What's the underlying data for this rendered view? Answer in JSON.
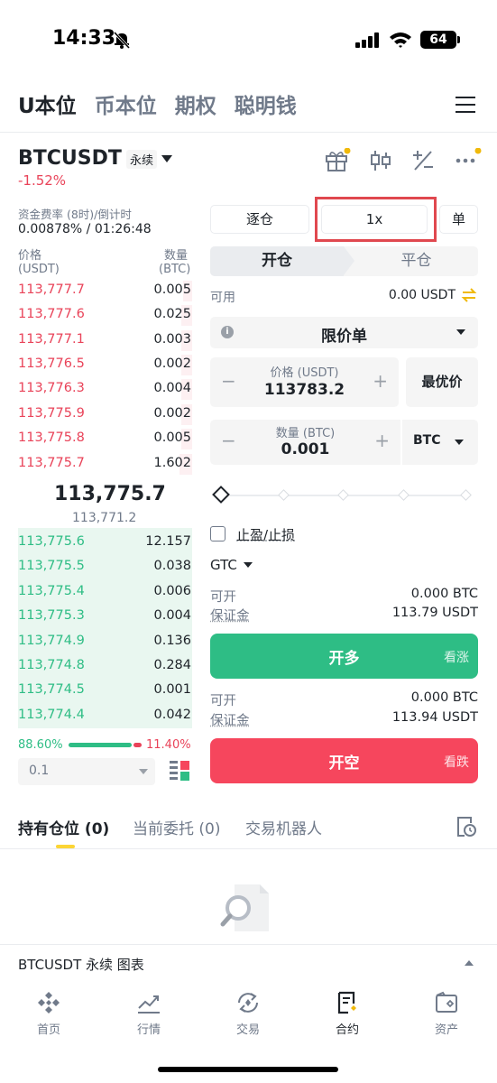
{
  "status_bar": {
    "time": "14:33",
    "battery": "64"
  },
  "top_tabs": [
    "U本位",
    "币本位",
    "期权",
    "聪明钱"
  ],
  "pair": {
    "name": "BTCUSDT",
    "type": "永续",
    "change": "-1.52%"
  },
  "funding": {
    "label": "资金费率 (8时)/倒计时",
    "value": "0.00878% / 01:26:48"
  },
  "orderbook": {
    "price_header": "价格",
    "price_unit": "(USDT)",
    "qty_header": "数量",
    "qty_unit": "(BTC)",
    "asks": [
      {
        "price": "113,777.7",
        "qty": "0.005",
        "depth": 0.05
      },
      {
        "price": "113,777.6",
        "qty": "0.025",
        "depth": 0.06
      },
      {
        "price": "113,777.1",
        "qty": "0.003",
        "depth": 0.06
      },
      {
        "price": "113,776.5",
        "qty": "0.002",
        "depth": 0.06
      },
      {
        "price": "113,776.3",
        "qty": "0.004",
        "depth": 0.06
      },
      {
        "price": "113,775.9",
        "qty": "0.002",
        "depth": 0.06
      },
      {
        "price": "113,775.8",
        "qty": "0.005",
        "depth": 0.06
      },
      {
        "price": "113,775.7",
        "qty": "1.602",
        "depth": 0.07
      }
    ],
    "last_price": "113,775.7",
    "mark_price": "113,771.2",
    "bids": [
      {
        "price": "113,775.6",
        "qty": "12.157"
      },
      {
        "price": "113,775.5",
        "qty": "0.038"
      },
      {
        "price": "113,775.4",
        "qty": "0.006"
      },
      {
        "price": "113,775.3",
        "qty": "0.004"
      },
      {
        "price": "113,774.9",
        "qty": "0.136"
      },
      {
        "price": "113,774.8",
        "qty": "0.284"
      },
      {
        "price": "113,774.5",
        "qty": "0.001"
      },
      {
        "price": "113,774.4",
        "qty": "0.042"
      }
    ],
    "buy_ratio": "88.60%",
    "sell_ratio": "11.40%",
    "precision": "0.1"
  },
  "order_form": {
    "margin_mode": "逐仓",
    "leverage": "1x",
    "position_mode": "单",
    "open_tab": "开仓",
    "close_tab": "平仓",
    "available_label": "可用",
    "available_value": "0.00 USDT",
    "order_type": "限价单",
    "price_label": "价格 (USDT)",
    "price_value": "113783.2",
    "best_price": "最优价",
    "qty_label": "数量 (BTC)",
    "qty_value": "0.001",
    "qty_unit": "BTC",
    "tpsl_label": "止盈/止损",
    "tif": "GTC",
    "long": {
      "max_label": "可开",
      "max_value": "0.000 BTC",
      "margin_label": "保证金",
      "margin_value": "113.79 USDT",
      "button": "开多",
      "sub": "看涨"
    },
    "short": {
      "max_label": "可开",
      "max_value": "0.000 BTC",
      "margin_label": "保证金",
      "margin_value": "113.94 USDT",
      "button": "开空",
      "sub": "看跌"
    }
  },
  "position_tabs": [
    "持有仓位 (0)",
    "当前委托 (0)",
    "交易机器人"
  ],
  "chart_bar": "BTCUSDT 永续  图表",
  "bottom_nav": [
    "首页",
    "行情",
    "交易",
    "合约",
    "资产"
  ],
  "colors": {
    "green": "#2ebd85",
    "red": "#f6465d",
    "accent": "#fcd535",
    "highlight": "#e0484f"
  }
}
